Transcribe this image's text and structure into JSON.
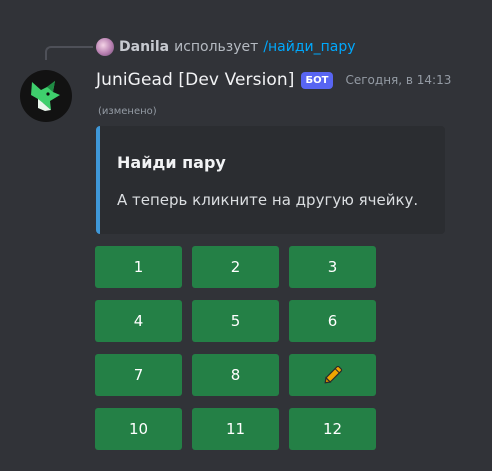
{
  "reply": {
    "user": "Danila",
    "action": "использует",
    "command": "/найди_пару"
  },
  "message": {
    "username": "JuniGead [Dev Version]",
    "bot_tag": "БОТ",
    "timestamp": "Сегодня, в 14:13",
    "edited": "(изменено)"
  },
  "embed": {
    "title": "Найди пару",
    "description": "А теперь кликните на другую ячейку.",
    "accent_color": "#3f98d8"
  },
  "buttons": [
    {
      "label": "1"
    },
    {
      "label": "2"
    },
    {
      "label": "3"
    },
    {
      "label": "4"
    },
    {
      "label": "5"
    },
    {
      "label": "6"
    },
    {
      "label": "7"
    },
    {
      "label": "8"
    },
    {
      "label": "",
      "icon": "crayon-icon"
    },
    {
      "label": "10"
    },
    {
      "label": "11"
    },
    {
      "label": "12"
    }
  ],
  "colors": {
    "background": "#313338",
    "button_green": "#248046",
    "bot_tag": "#5865f2",
    "command_link": "#00a8fc"
  }
}
